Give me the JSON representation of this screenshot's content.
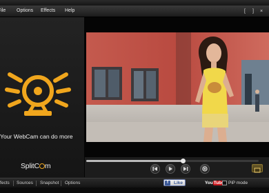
{
  "menu": {
    "items": [
      "File",
      "Options",
      "Effects",
      "Help"
    ],
    "window_buttons": [
      "[",
      "]",
      "×"
    ]
  },
  "left_panel": {
    "promo_text": "Your WebCam can do more",
    "promo_icon": "webcam-icon",
    "brand_prefix": "Split",
    "brand_c": "C",
    "brand_suffix": "m"
  },
  "player": {
    "progress_fraction": 0.56,
    "controls": [
      "previous-icon",
      "play-icon",
      "next-icon",
      "record-icon"
    ]
  },
  "bottom": {
    "tabs": [
      "Effects",
      "Sources",
      "Snapshot",
      "Options"
    ],
    "like_label": "Like",
    "youtube_you": "You",
    "youtube_tube": "Tube",
    "pip_label": "PiP mode"
  },
  "colors": {
    "accent": "#f0a61d",
    "facebook": "#3b5998",
    "youtube": "#cc181e"
  }
}
